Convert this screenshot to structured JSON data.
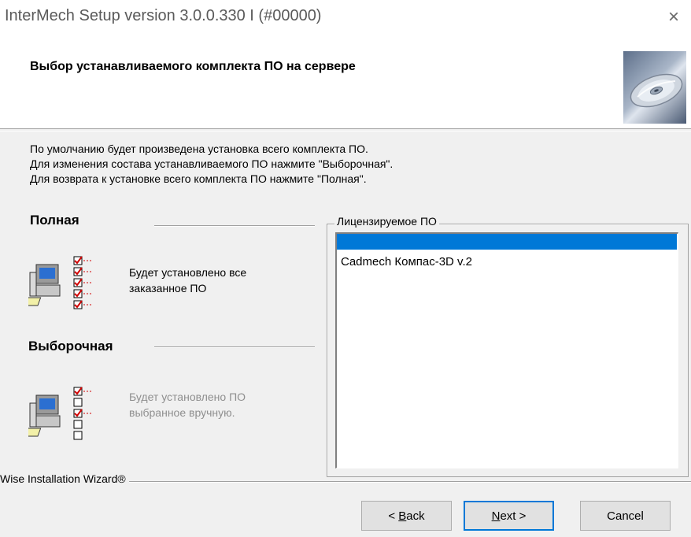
{
  "window": {
    "title": "InterMech Setup version 3.0.0.330 I (#00000)",
    "close_glyph": "×"
  },
  "header": {
    "title": "Выбор устанавливаемого комплекта ПО на сервере",
    "icon": "cd-disc-icon"
  },
  "description": {
    "lines": [
      "По умолчанию будет произведена установка всего комплекта ПО.",
      "Для изменения состава устанавливаемого ПО нажмите \"Выборочная\".",
      "Для возврата к установке всего комплекта ПО нажмите \"Полная\"."
    ]
  },
  "options": {
    "full": {
      "heading": "Полная",
      "text_line1": "Будет установлено все",
      "text_line2": "заказанное ПО",
      "icon": "computer-checklist-icon"
    },
    "custom": {
      "heading": "Выборочная",
      "text_line1": "Будет установлено ПО",
      "text_line2": "выбранное вручную.",
      "icon": "computer-partial-checklist-icon"
    }
  },
  "licensed": {
    "legend": "Лицензируемое ПО",
    "items": [
      "",
      "Cadmech Компас-3D v.2"
    ],
    "selected_color": "#0078d7"
  },
  "footer": {
    "wizard_label": "Wise Installation Wizard®",
    "buttons": {
      "back_prefix": "< ",
      "back_mnemonic": "B",
      "back_rest": "ack",
      "next_mnemonic": "N",
      "next_rest": "ext >",
      "cancel": "Cancel"
    }
  }
}
